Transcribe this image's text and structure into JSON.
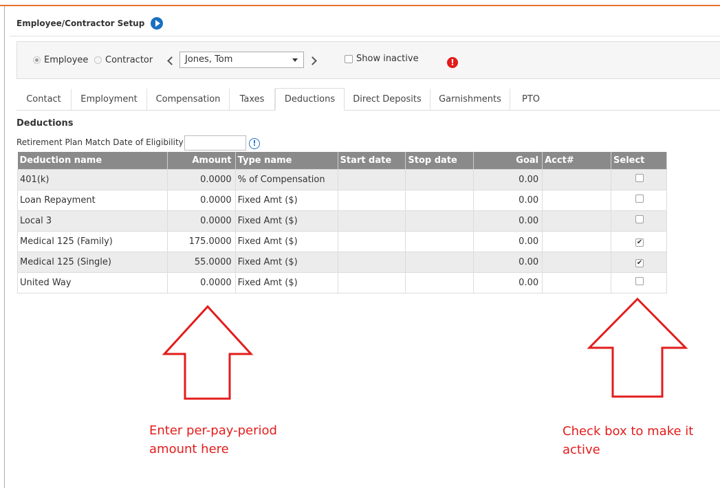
{
  "header": {
    "title": "Employee/Contractor Setup"
  },
  "toolbar": {
    "employee_label": "Employee",
    "contractor_label": "Contractor",
    "selected_person": "Jones, Tom",
    "show_inactive_label": "Show inactive",
    "warning_glyph": "!"
  },
  "tabs": [
    {
      "label": "Contact"
    },
    {
      "label": "Employment"
    },
    {
      "label": "Compensation"
    },
    {
      "label": "Taxes"
    },
    {
      "label": "Deductions"
    },
    {
      "label": "Direct Deposits"
    },
    {
      "label": "Garnishments"
    },
    {
      "label": "PTO"
    }
  ],
  "active_tab": "Deductions",
  "section": {
    "title": "Deductions",
    "eligibility_label": "Retirement Plan Match Date of Eligibility",
    "eligibility_value": "",
    "info_glyph": "!"
  },
  "table": {
    "columns": [
      "Deduction name",
      "Amount",
      "Type name",
      "Start date",
      "Stop date",
      "Goal",
      "Acct#",
      "Select"
    ],
    "rows": [
      {
        "name": "401(k)",
        "amount": "0.0000",
        "type": "% of Compensation",
        "start": "",
        "stop": "",
        "goal": "0.00",
        "acct": "",
        "selected": false
      },
      {
        "name": "Loan Repayment",
        "amount": "0.0000",
        "type": "Fixed Amt ($)",
        "start": "",
        "stop": "",
        "goal": "0.00",
        "acct": "",
        "selected": false
      },
      {
        "name": "Local 3",
        "amount": "0.0000",
        "type": "Fixed Amt ($)",
        "start": "",
        "stop": "",
        "goal": "0.00",
        "acct": "",
        "selected": false
      },
      {
        "name": "Medical 125 (Family)",
        "amount": "175.0000",
        "type": "Fixed Amt ($)",
        "start": "",
        "stop": "",
        "goal": "0.00",
        "acct": "",
        "selected": true
      },
      {
        "name": "Medical 125 (Single)",
        "amount": "55.0000",
        "type": "Fixed Amt ($)",
        "start": "",
        "stop": "",
        "goal": "0.00",
        "acct": "",
        "selected": true
      },
      {
        "name": "United Way",
        "amount": "0.0000",
        "type": "Fixed Amt ($)",
        "start": "",
        "stop": "",
        "goal": "0.00",
        "acct": "",
        "selected": false
      }
    ]
  },
  "annotations": {
    "amount_note_line1": "Enter per-pay-period",
    "amount_note_line2": "amount here",
    "select_note_line1": "Check box to make it",
    "select_note_line2": "active",
    "color": "#e31c1c"
  }
}
